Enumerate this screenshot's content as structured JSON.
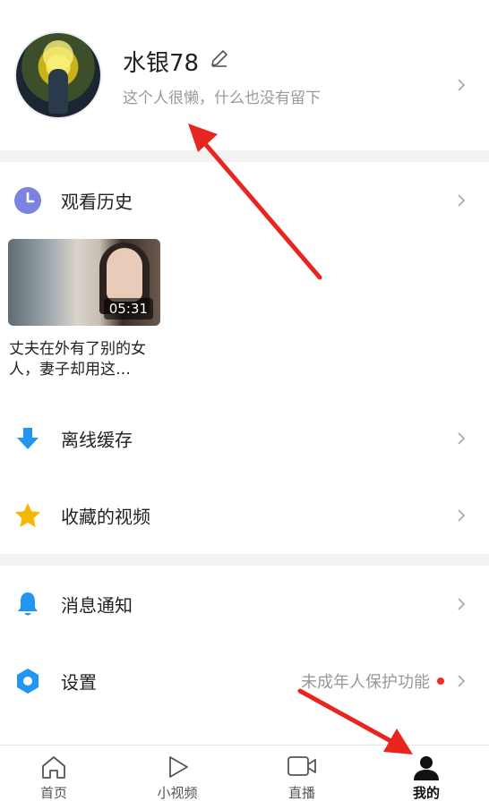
{
  "profile": {
    "username": "水银78",
    "bio": "这个人很懒，什么也没有留下"
  },
  "history": {
    "label": "观看历史",
    "video": {
      "duration": "05:31",
      "title": "丈夫在外有了别的女人，妻子却用这…"
    }
  },
  "menu": {
    "offline": "离线缓存",
    "favorites": "收藏的视频",
    "notifications": "消息通知",
    "settings": "设置",
    "settings_extra": "未成年人保护功能"
  },
  "tabbar": {
    "home": "首页",
    "short_video": "小视频",
    "live": "直播",
    "mine": "我的"
  },
  "colors": {
    "history_icon": "#7b82e0",
    "offline_icon": "#2196f3",
    "favorites_icon": "#f5b800",
    "notifications_icon": "#2196f3",
    "settings_icon": "#2196f3",
    "annotation_arrow": "#e8261f",
    "badge_dot": "#f02b2b"
  }
}
